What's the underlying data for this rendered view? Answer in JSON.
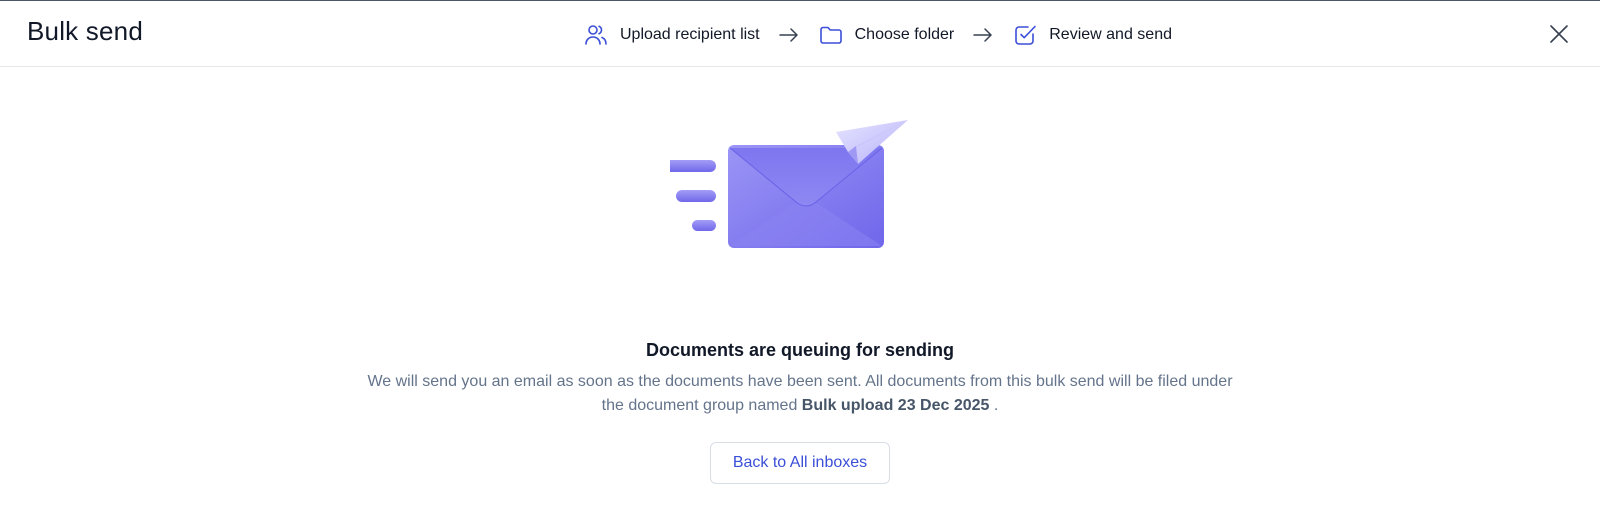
{
  "header": {
    "title": "Bulk send",
    "steps": [
      {
        "label": "Upload recipient list",
        "icon": "users-icon"
      },
      {
        "label": "Choose folder",
        "icon": "folder-icon"
      },
      {
        "label": "Review and send",
        "icon": "check-square-icon"
      }
    ],
    "close_icon": "close-icon"
  },
  "main": {
    "illustration_icon": "envelope-paper-plane-icon",
    "heading": "Documents are queuing for sending",
    "description_part1": "We will send you an email as soon as the documents have been sent. All documents from this bulk send will be filed under the document group named",
    "group_name": "Bulk upload 23 Dec 2025",
    "description_part2": ".",
    "back_button": "Back to All inboxes"
  },
  "colors": {
    "accent": "#3b4fd8",
    "illustration": "#7b73ee",
    "text_muted": "#64748b"
  }
}
